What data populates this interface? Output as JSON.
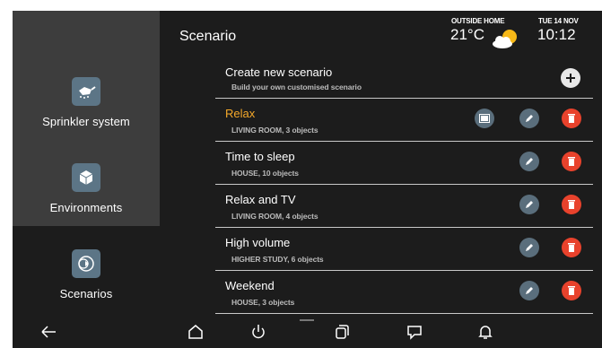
{
  "header": {
    "title": "Scenario",
    "outside_label": "OUTSIDE HOME",
    "temperature": "21°C",
    "date": "TUE 14 NOV",
    "time": "10:12",
    "weather_icon": "partly-cloudy-icon"
  },
  "sidebar": {
    "items": [
      {
        "label": "Sprinkler system",
        "icon": "sprinkler-icon",
        "active": false
      },
      {
        "label": "Environments",
        "icon": "cube-icon",
        "active": false
      },
      {
        "label": "Scenarios",
        "icon": "scenarios-icon",
        "active": true
      }
    ]
  },
  "create": {
    "title": "Create new scenario",
    "subtitle": "Build your own customised scenario"
  },
  "scenarios": [
    {
      "name": "Relax",
      "detail": "LIVING ROOM, 3 objects",
      "active": true
    },
    {
      "name": "Time to sleep",
      "detail": "HOUSE, 10 objects",
      "active": false
    },
    {
      "name": "Relax and TV",
      "detail": "LIVING ROOM, 4 objects",
      "active": false
    },
    {
      "name": "High volume",
      "detail": "HIGHER STUDY, 6 objects",
      "active": false
    },
    {
      "name": "Weekend",
      "detail": "HOUSE, 3 objects",
      "active": false
    }
  ],
  "navbar": [
    "back-icon",
    "home-icon",
    "power-icon",
    "copy-icon",
    "chat-icon",
    "bell-icon"
  ],
  "colors": {
    "accent": "#f4a82a",
    "delete": "#e8422c",
    "edit": "#5a6e7c",
    "background": "#1c1c1c",
    "sidebar": "#3d3d3d"
  }
}
